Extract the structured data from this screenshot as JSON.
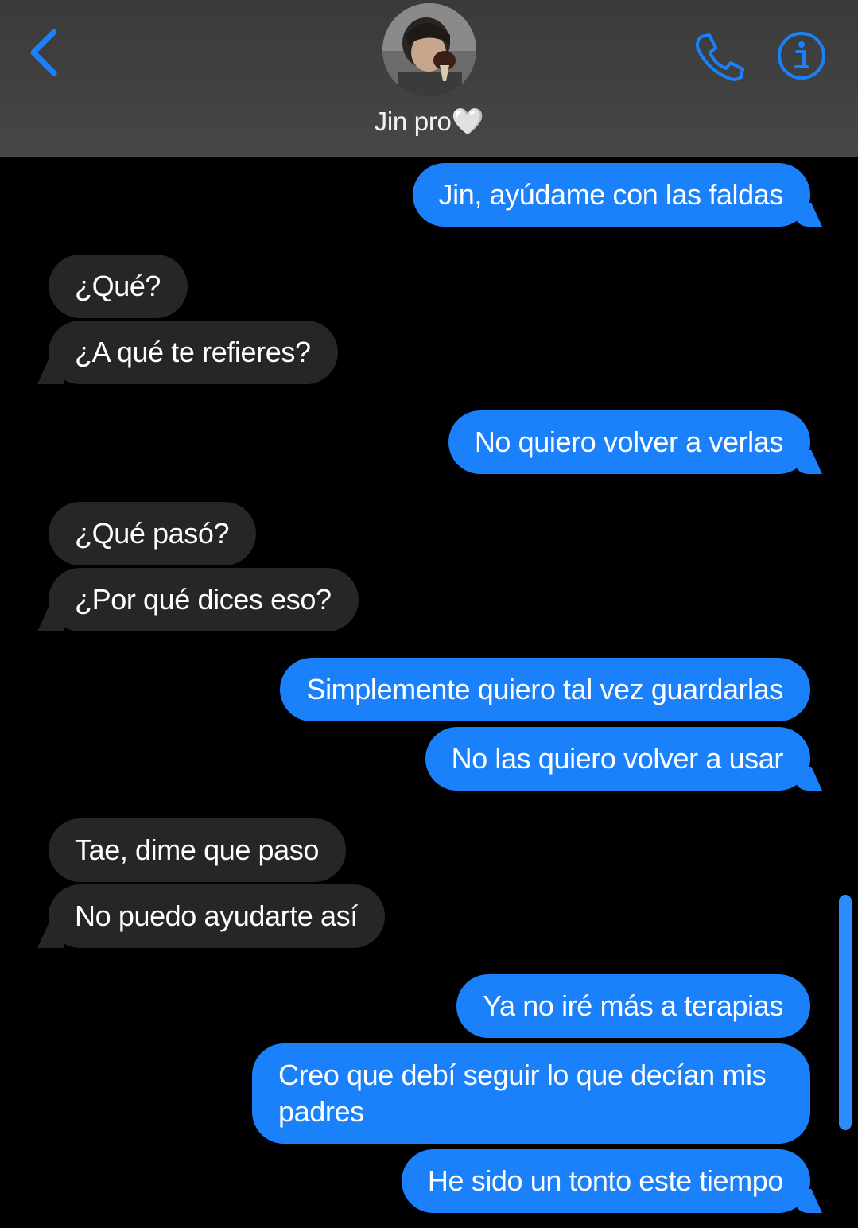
{
  "header": {
    "contact_name": "Jin pro🤍",
    "icons": {
      "back": "chevron-left-icon",
      "call": "phone-icon",
      "info": "info-icon"
    },
    "accent_color": "#1b81fb",
    "header_color": "#434343"
  },
  "messages": [
    {
      "from": "me",
      "text": "Jin, ayúdame con las faldas"
    },
    {
      "from": "them",
      "text": "¿Qué?"
    },
    {
      "from": "them",
      "text": "¿A qué te refieres?"
    },
    {
      "from": "me",
      "text": "No quiero volver a verlas"
    },
    {
      "from": "them",
      "text": "¿Qué pasó?"
    },
    {
      "from": "them",
      "text": "¿Por qué dices eso?"
    },
    {
      "from": "me",
      "text": "Simplemente quiero tal vez guardarlas"
    },
    {
      "from": "me",
      "text": "No las quiero volver a usar"
    },
    {
      "from": "them",
      "text": "Tae, dime que paso"
    },
    {
      "from": "them",
      "text": "No puedo ayudarte así"
    },
    {
      "from": "me",
      "text": "Ya no iré más a terapias"
    },
    {
      "from": "me",
      "text": "Creo que debí seguir lo que decían mis padres"
    },
    {
      "from": "me",
      "text": "He sido un tonto este tiempo"
    }
  ],
  "colors": {
    "outgoing_bubble": "#1b81fb",
    "incoming_bubble": "#262628",
    "background": "#000000"
  }
}
